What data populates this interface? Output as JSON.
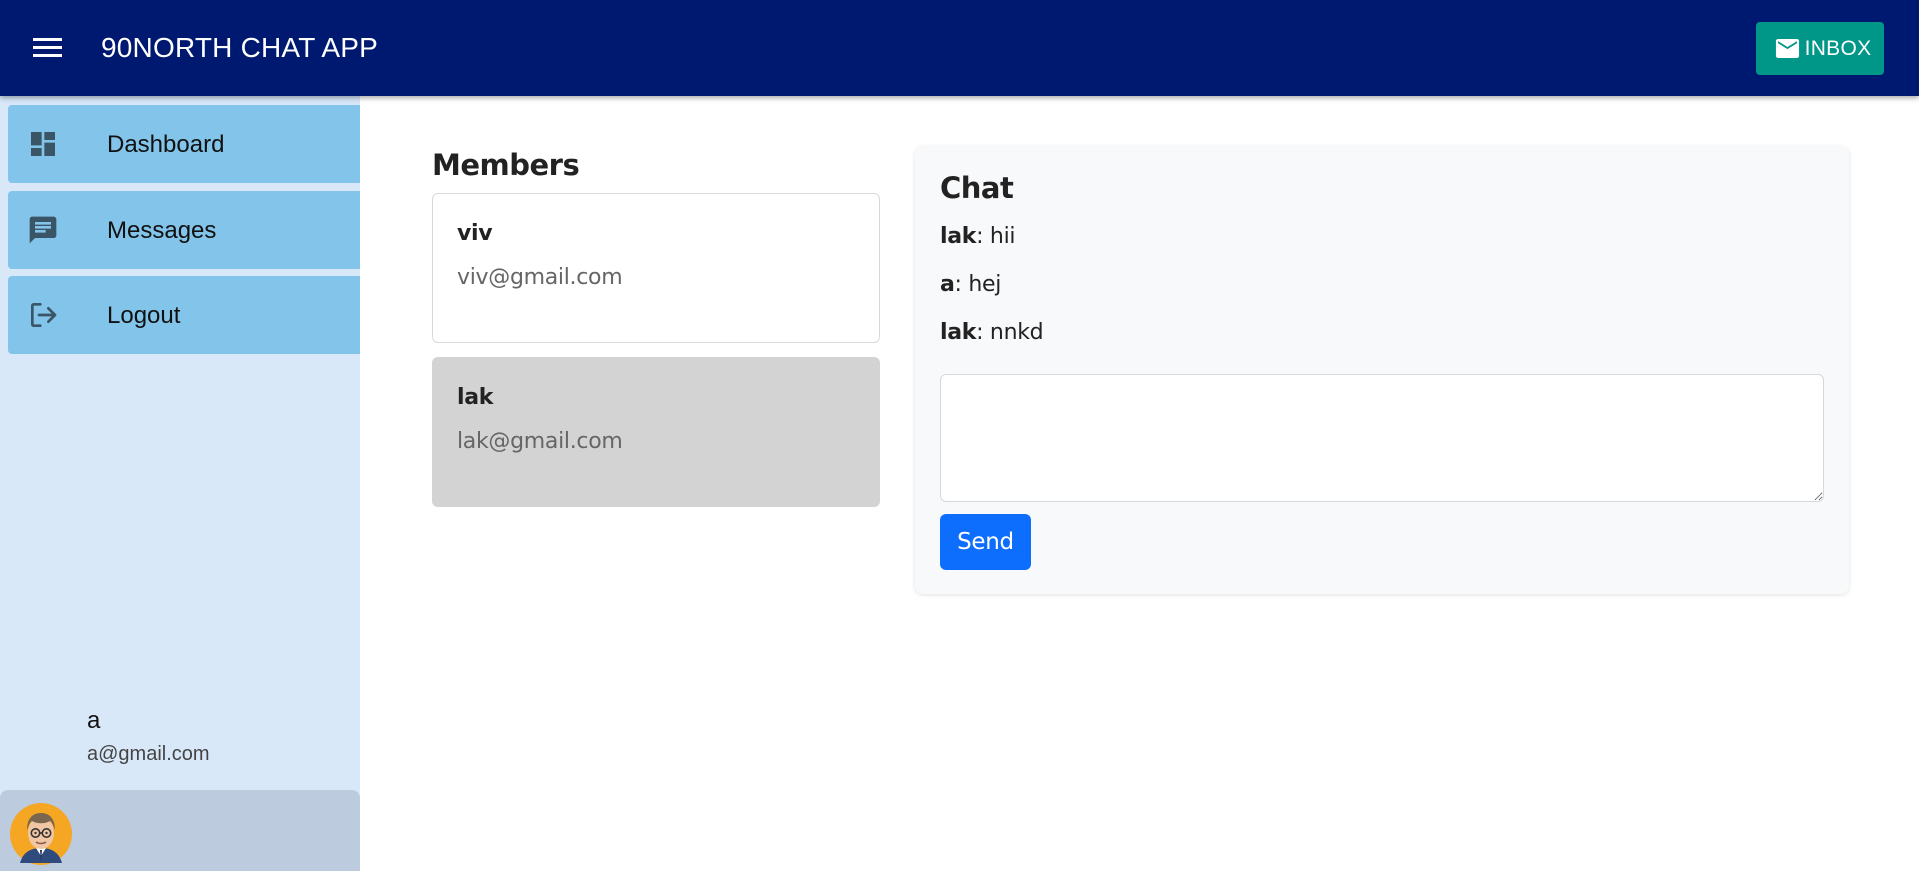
{
  "header": {
    "title": "90NORTH CHAT APP",
    "inbox_label": "INBOX",
    "menu_icon": "hamburger-menu-icon",
    "inbox_icon": "mail-icon",
    "background_color": "#001970",
    "inbox_color": "#009688"
  },
  "sidebar": {
    "items": [
      {
        "label": "Dashboard",
        "icon": "dashboard-icon"
      },
      {
        "label": "Messages",
        "icon": "chat-bubble-icon"
      },
      {
        "label": "Logout",
        "icon": "logout-icon"
      }
    ],
    "item_color": "#82c4ea",
    "background_color": "#d8e8f9",
    "user": {
      "name": "a",
      "email": "a@gmail.com",
      "avatar_icon": "user-avatar"
    }
  },
  "members": {
    "title": "Members",
    "items": [
      {
        "name": "viv",
        "email": "viv@gmail.com",
        "selected": false
      },
      {
        "name": "lak",
        "email": "lak@gmail.com",
        "selected": true
      }
    ]
  },
  "chat": {
    "title": "Chat",
    "messages": [
      {
        "sender": "lak",
        "text": ": hii"
      },
      {
        "sender": "a",
        "text": ": hej"
      },
      {
        "sender": "lak",
        "text": ": nnkd"
      }
    ],
    "input_value": "",
    "send_label": "Send",
    "send_color": "#0d6efd"
  }
}
